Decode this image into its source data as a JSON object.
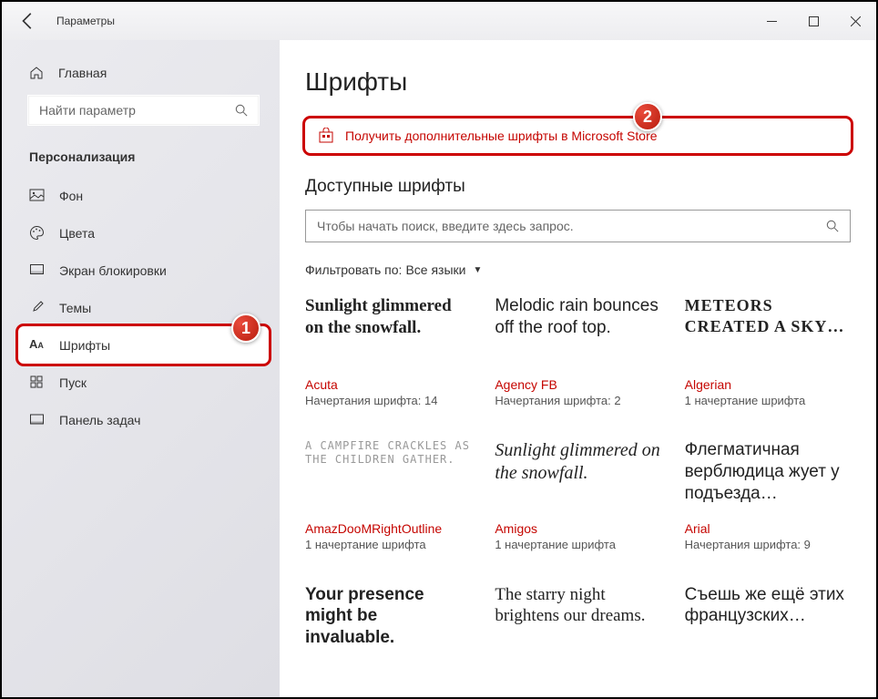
{
  "window": {
    "title": "Параметры"
  },
  "sidebar": {
    "home": "Главная",
    "search_placeholder": "Найти параметр",
    "section": "Персонализация",
    "items": [
      {
        "label": "Фон",
        "icon": "image-icon"
      },
      {
        "label": "Цвета",
        "icon": "palette-icon"
      },
      {
        "label": "Экран блокировки",
        "icon": "lock-screen-icon"
      },
      {
        "label": "Темы",
        "icon": "brush-icon"
      },
      {
        "label": "Шрифты",
        "icon": "font-icon",
        "highlighted": true
      },
      {
        "label": "Пуск",
        "icon": "start-icon"
      },
      {
        "label": "Панель задач",
        "icon": "taskbar-icon"
      }
    ]
  },
  "main": {
    "title": "Шрифты",
    "store_link": "Получить дополнительные шрифты в Microsoft Store",
    "available_header": "Доступные шрифты",
    "search_placeholder": "Чтобы начать поиск, введите здесь запрос.",
    "filter_label": "Фильтровать по:",
    "filter_value": "Все языки"
  },
  "fonts": [
    {
      "sample": "Sunlight glimmered on the snowfall.",
      "name": "Acuta",
      "meta": "Начертания шрифта: 14",
      "cls": "sample-acuta"
    },
    {
      "sample": "Melodic rain bounces off the roof top.",
      "name": "Agency FB",
      "meta": "Начертания шрифта: 2",
      "cls": "sample-agency"
    },
    {
      "sample": "Meteors created a sky…",
      "name": "Algerian",
      "meta": "1 начертание шрифта",
      "cls": "sample-algerian"
    },
    {
      "sample": "A campfire crackles as the children gather.",
      "name": "AmazDooMRightOutline",
      "meta": "1 начертание шрифта",
      "cls": "sample-amaz"
    },
    {
      "sample": "Sunlight glimmered on the snowfall.",
      "name": "Amigos",
      "meta": "1 начертание шрифта",
      "cls": "sample-amigos"
    },
    {
      "sample": "Флегматичная верблюдица жует у подъезда…",
      "name": "Arial",
      "meta": "Начертания шрифта: 9",
      "cls": "sample-arial"
    },
    {
      "sample": "Your presence might be invaluable.",
      "name": "",
      "meta": "",
      "cls": "sample-bold"
    },
    {
      "sample": "The starry night brightens our dreams.",
      "name": "",
      "meta": "",
      "cls": "sample-serif"
    },
    {
      "sample": "Съешь же ещё этих французских…",
      "name": "",
      "meta": "",
      "cls": "sample-plain"
    }
  ],
  "annotations": {
    "badge1": "1",
    "badge2": "2"
  }
}
